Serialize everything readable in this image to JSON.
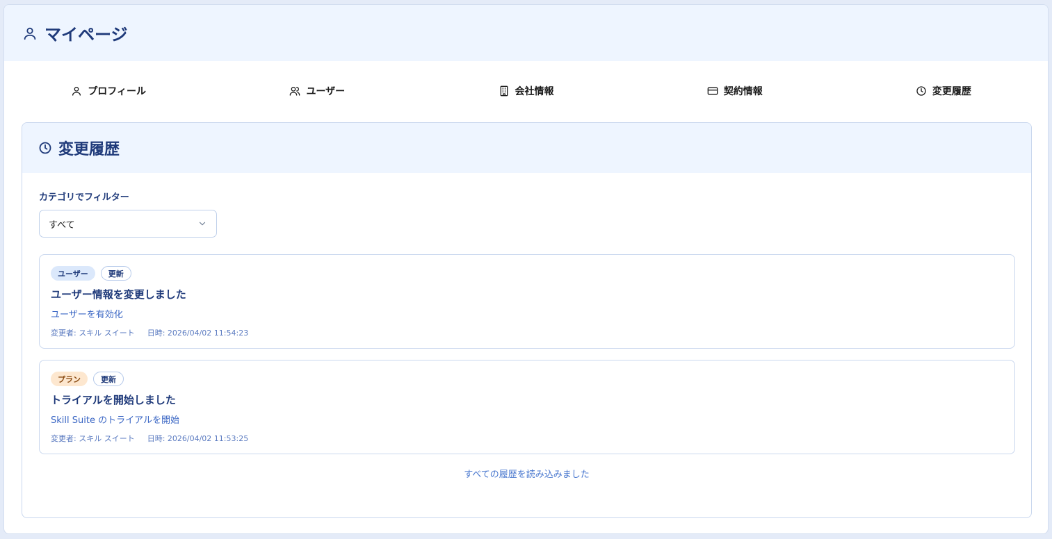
{
  "header": {
    "title": "マイページ",
    "icon": "user-icon"
  },
  "tabs": [
    {
      "label": "プロフィール",
      "icon": "user-icon"
    },
    {
      "label": "ユーザー",
      "icon": "users-icon"
    },
    {
      "label": "会社情報",
      "icon": "building-icon"
    },
    {
      "label": "契約情報",
      "icon": "credit-card-icon"
    },
    {
      "label": "変更履歴",
      "icon": "clock-icon"
    }
  ],
  "history": {
    "title": "変更履歴",
    "icon": "clock-icon",
    "filter": {
      "label": "カテゴリでフィルター",
      "selected": "すべて"
    },
    "items": [
      {
        "category": "ユーザー",
        "action": "更新",
        "title": "ユーザー情報を変更しました",
        "description": "ユーザーを有効化",
        "changed_by": "変更者: スキル スイート",
        "datetime": "日時: 2026/04/02 11:54:23"
      },
      {
        "category": "プラン",
        "action": "更新",
        "title": "トライアルを開始しました",
        "description": "Skill Suite のトライアルを開始",
        "changed_by": "変更者: スキル スイート",
        "datetime": "日時: 2026/04/02 11:53:25"
      }
    ],
    "end_message": "すべての履歴を読み込みました"
  },
  "colors": {
    "primary": "#1f3a7a",
    "header_bg": "#eef5ff",
    "link": "#3a66c4",
    "badge_user_bg": "#dbe8fb",
    "badge_plan_bg": "#fde7cf"
  }
}
